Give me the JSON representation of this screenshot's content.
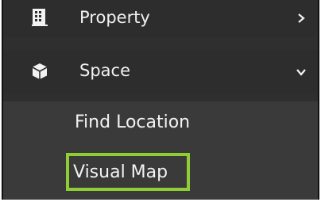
{
  "menu": {
    "property": {
      "label": "Property",
      "icon": "building-icon"
    },
    "space": {
      "label": "Space",
      "icon": "cube-icon"
    },
    "submenu": [
      {
        "label": "Find Location"
      },
      {
        "label": "Visual Map"
      }
    ]
  },
  "colors": {
    "highlight": "#8fcd35",
    "panel": "#2f2f2f",
    "subpanel": "#3a3a3a",
    "text": "#f2f2f2"
  }
}
